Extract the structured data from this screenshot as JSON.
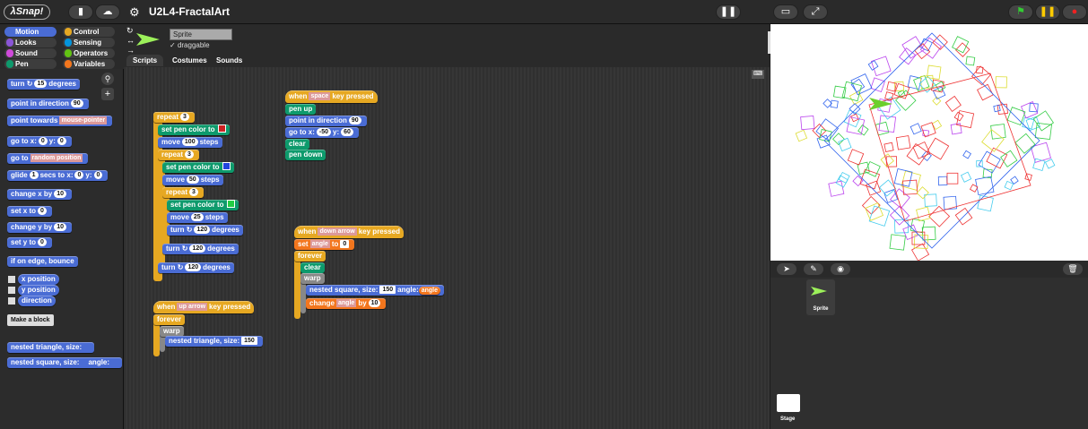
{
  "app": {
    "logo_text": "λSnap!",
    "project_title": "U2L4-FractalArt"
  },
  "categories": [
    {
      "label": "Motion",
      "color": "#4a6cd4"
    },
    {
      "label": "Control",
      "color": "#e6a822"
    },
    {
      "label": "Looks",
      "color": "#8a55d7"
    },
    {
      "label": "Sensing",
      "color": "#0494dc"
    },
    {
      "label": "Sound",
      "color": "#cf4ad9"
    },
    {
      "label": "Operators",
      "color": "#62c213"
    },
    {
      "label": "Pen",
      "color": "#0e9a6c"
    },
    {
      "label": "Variables",
      "color": "#f3761d"
    }
  ],
  "palette": {
    "turn": {
      "text": "turn ↻",
      "value": "15",
      "suffix": "degrees"
    },
    "point_dir": {
      "text": "point in direction",
      "value": "90"
    },
    "point_towards": {
      "text": "point towards",
      "value": "mouse-pointer"
    },
    "goto_xy": {
      "text": "go to x:",
      "x": "0",
      "ylabel": "y:",
      "y": "0"
    },
    "goto": {
      "text": "go to",
      "value": "random position"
    },
    "glide": {
      "text": "glide",
      "secs": "1",
      "mid": "secs to x:",
      "x": "0",
      "ylabel": "y:",
      "y": "0"
    },
    "change_x": {
      "text": "change x by",
      "value": "10"
    },
    "set_x": {
      "text": "set x to",
      "value": "0"
    },
    "change_y": {
      "text": "change y by",
      "value": "10"
    },
    "set_y": {
      "text": "set y to",
      "value": "0"
    },
    "bounce": "if on edge, bounce",
    "x_position": "x position",
    "y_position": "y position",
    "direction": "direction",
    "make_block": "Make a block",
    "nested_triangle": "nested triangle, size:",
    "nested_square": "nested square, size:",
    "angle_label": "angle:"
  },
  "sprite": {
    "name": "Sprite",
    "draggable": "draggable"
  },
  "tabs": [
    "Scripts",
    "Costumes",
    "Sounds"
  ],
  "scripts": {
    "s1": {
      "repeat_label": "repeat",
      "repeat1": "3",
      "set_pen": "set pen color to",
      "move": "move",
      "steps": "steps",
      "move1": "100",
      "move2": "50",
      "move3": "25",
      "repeat2": "3",
      "repeat3": "3",
      "turn": "turn ↻",
      "degrees": "degrees",
      "turn_val": "120"
    },
    "s2": {
      "when": "when",
      "key1": "space",
      "key_pressed": "key pressed",
      "pen_up": "pen up",
      "point_dir": "point in direction",
      "dir": "90",
      "goto": "go to x:",
      "x": "-50",
      "ylabel": "y:",
      "y": "60",
      "clear": "clear",
      "pen_down": "pen down"
    },
    "s3": {
      "when": "when",
      "key": "down arrow",
      "key_pressed": "key pressed",
      "set": "set",
      "var": "angle",
      "to": "to",
      "val": "0",
      "forever": "forever",
      "clear": "clear",
      "warp": "warp",
      "nested": "nested square, size:",
      "size": "150",
      "angle_label": "angle:",
      "angle_var": "angle",
      "change": "change",
      "by": "by",
      "by_val": "10"
    },
    "s4": {
      "when": "when",
      "key": "up arrow",
      "key_pressed": "key pressed",
      "forever": "forever",
      "warp": "warp",
      "nested": "nested triangle, size:",
      "size": "150"
    }
  },
  "corral": {
    "sprite_label": "Sprite",
    "stage_label": "Stage"
  },
  "colors": {
    "pen_red": "#cc2222",
    "pen_blue": "#2244dd",
    "pen_green": "#22cc44",
    "stage_bg": "#ffffff"
  }
}
